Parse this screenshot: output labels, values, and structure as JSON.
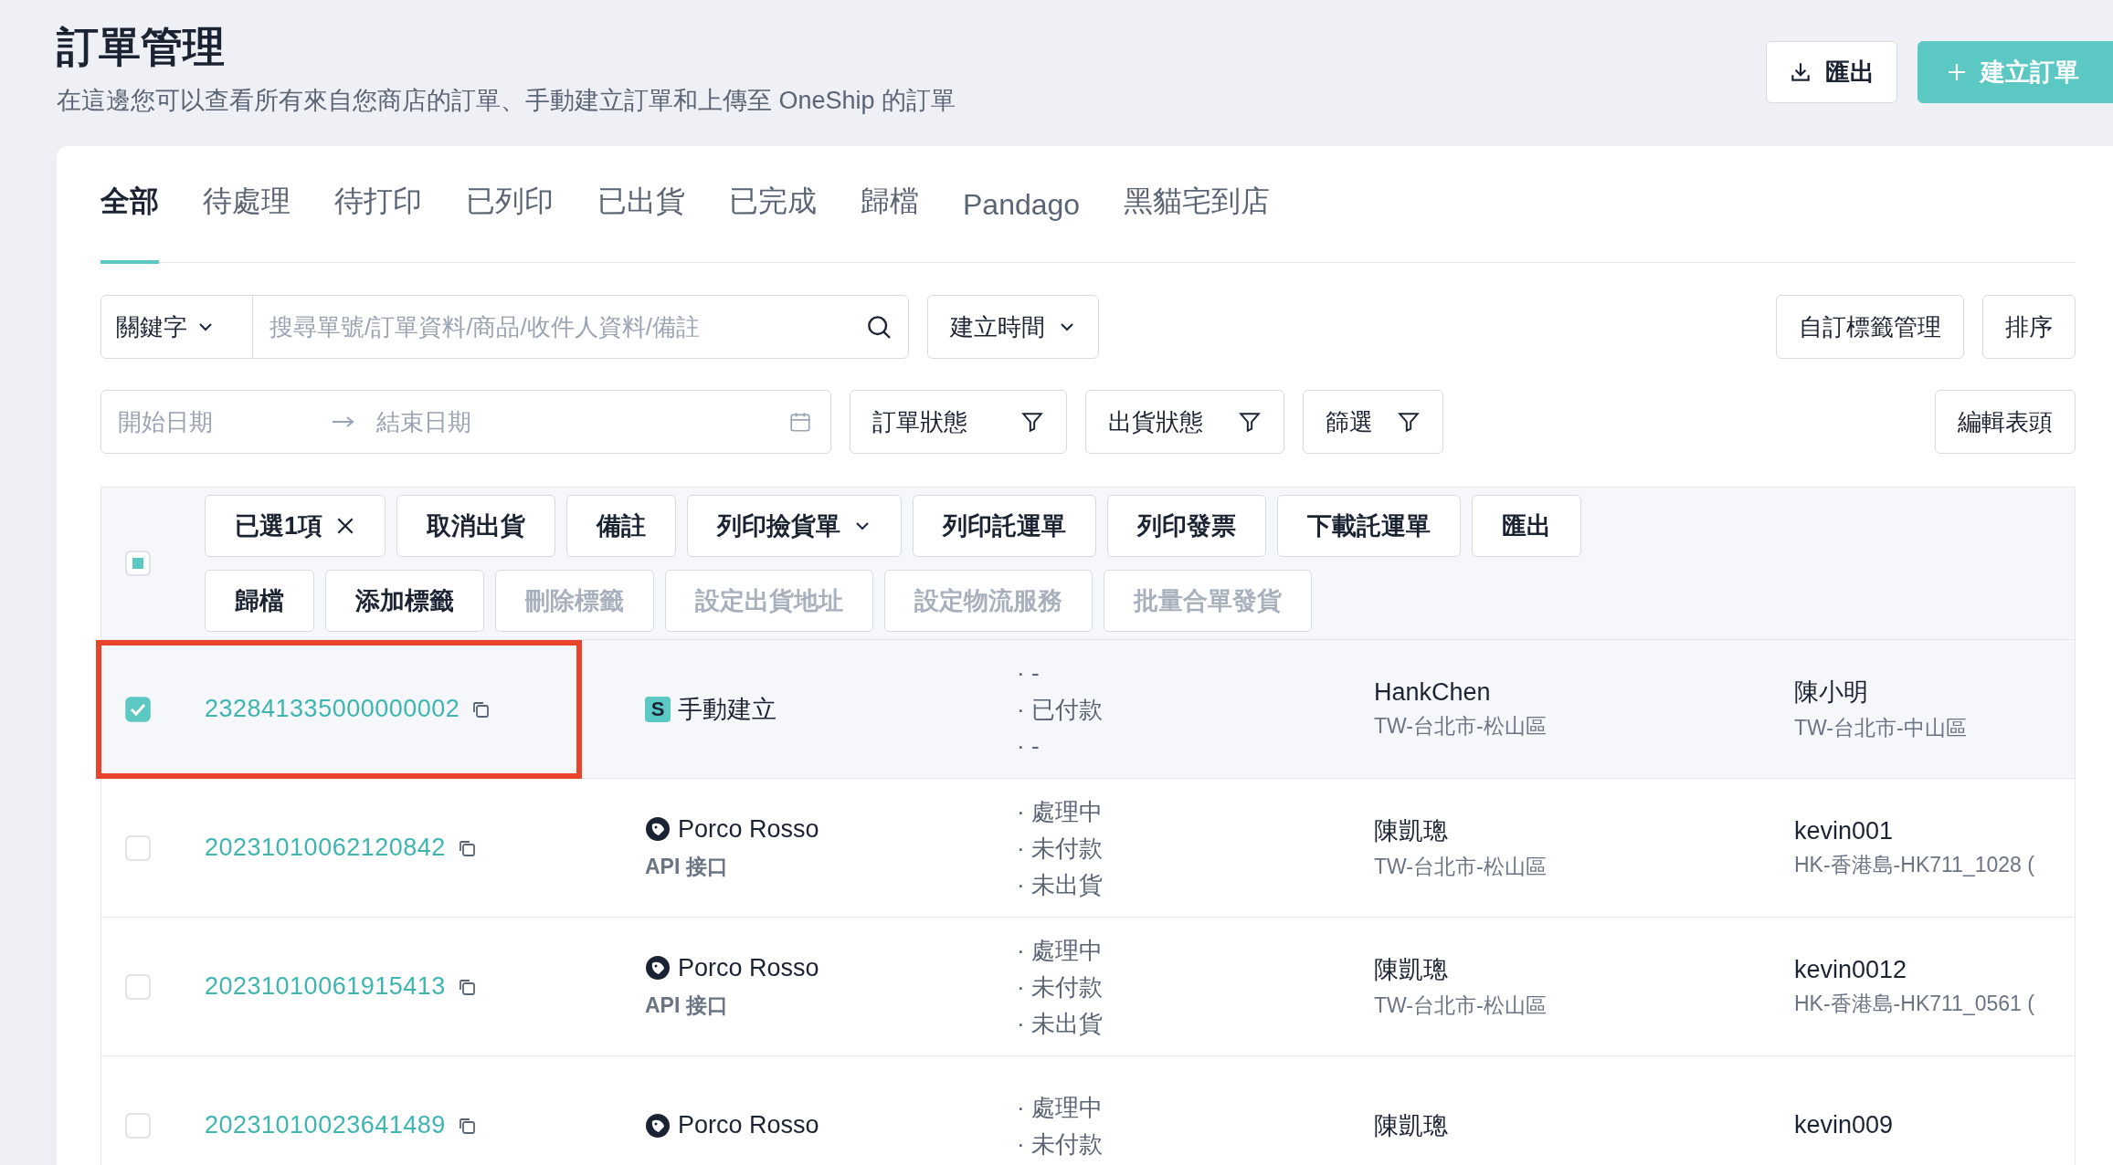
{
  "header": {
    "title": "訂單管理",
    "subtitle": "在這邊您可以查看所有來自您商店的訂單、手動建立訂單和上傳至 OneShip 的訂單",
    "actions": [
      {
        "label": "匯出",
        "kind": "export"
      },
      {
        "label": "建立訂單",
        "kind": "create"
      }
    ]
  },
  "tabs": [
    {
      "label": "全部",
      "selected": true
    },
    {
      "label": "待處理",
      "selected": false
    },
    {
      "label": "待打印",
      "selected": false
    },
    {
      "label": "已列印",
      "selected": false
    },
    {
      "label": "已出貨",
      "selected": false
    },
    {
      "label": "已完成",
      "selected": false
    },
    {
      "label": "歸檔",
      "selected": false
    },
    {
      "label": "Pandago",
      "selected": false
    },
    {
      "label": "黑貓宅到店",
      "selected": false
    }
  ],
  "filters": {
    "keyword_select": "關鍵字",
    "search": {
      "placeholder": "搜尋單號/訂單資料/商品/收件人資料/備註"
    },
    "time_select": "建立時間",
    "tag_button": "自訂標籤管理",
    "sort_button": "排序",
    "start_date": {
      "placeholder": "開始日期"
    },
    "end_date": {
      "placeholder": "結束日期"
    },
    "filter_buttons": [
      "訂單狀態",
      "出貨狀態",
      "篩選"
    ],
    "columns_button": "編輯表頭"
  },
  "table": {
    "select_all": {
      "indeterminate": true
    },
    "bulk_actions": [
      [
        {
          "label": "已選1項",
          "kind": "clear",
          "disabled": false
        },
        {
          "label": "取消出貨",
          "kind": "plain",
          "disabled": false
        },
        {
          "label": "備註",
          "kind": "plain",
          "disabled": false
        },
        {
          "label": "列印撿貨單",
          "kind": "menu",
          "disabled": false
        },
        {
          "label": "列印託運單",
          "kind": "plain",
          "disabled": false
        },
        {
          "label": "列印發票",
          "kind": "plain",
          "disabled": false
        },
        {
          "label": "下載託運單",
          "kind": "plain",
          "disabled": false
        },
        {
          "label": "匯出",
          "kind": "plain",
          "disabled": false
        }
      ],
      [
        {
          "label": "歸檔",
          "kind": "plain",
          "disabled": false
        },
        {
          "label": "添加標籤",
          "kind": "plain",
          "disabled": false
        },
        {
          "label": "刪除標籤",
          "kind": "plain",
          "disabled": true
        },
        {
          "label": "設定出貨地址",
          "kind": "plain",
          "disabled": true
        },
        {
          "label": "設定物流服務",
          "kind": "plain",
          "disabled": true
        },
        {
          "label": "批量合單發貨",
          "kind": "plain",
          "disabled": true
        }
      ]
    ],
    "rows": [
      {
        "checked": true,
        "highlighted": true,
        "order_no": "232841335000000002",
        "source": {
          "kind": "manual",
          "badge": "S",
          "name": "手動建立"
        },
        "status": [
          "· -",
          "· 已付款",
          "· -"
        ],
        "customer": {
          "name": "HankChen",
          "address": "TW-台北市-松山區"
        },
        "recipient": {
          "name": "陳小明",
          "address": "TW-台北市-中山區"
        }
      },
      {
        "checked": false,
        "highlighted": false,
        "order_no": "20231010062120842",
        "source": {
          "kind": "api",
          "name": "Porco Rosso",
          "sub": "API 接口"
        },
        "status": [
          "· 處理中",
          "· 未付款",
          "· 未出貨"
        ],
        "customer": {
          "name": "陳凱璁",
          "address": "TW-台北市-松山區"
        },
        "recipient": {
          "name": "kevin001",
          "address": "HK-香港島-HK711_1028 ("
        }
      },
      {
        "checked": false,
        "highlighted": false,
        "order_no": "20231010061915413",
        "source": {
          "kind": "api",
          "name": "Porco Rosso",
          "sub": "API 接口"
        },
        "status": [
          "· 處理中",
          "· 未付款",
          "· 未出貨"
        ],
        "customer": {
          "name": "陳凱璁",
          "address": "TW-台北市-松山區"
        },
        "recipient": {
          "name": "kevin0012",
          "address": "HK-香港島-HK711_0561 ("
        }
      },
      {
        "checked": false,
        "highlighted": false,
        "order_no": "20231010023641489",
        "source": {
          "kind": "api",
          "name": "Porco Rosso"
        },
        "status": [
          "· 處理中",
          "· 未付款"
        ],
        "customer": {
          "name": "陳凱璁"
        },
        "recipient": {
          "name": "kevin009"
        }
      }
    ]
  }
}
